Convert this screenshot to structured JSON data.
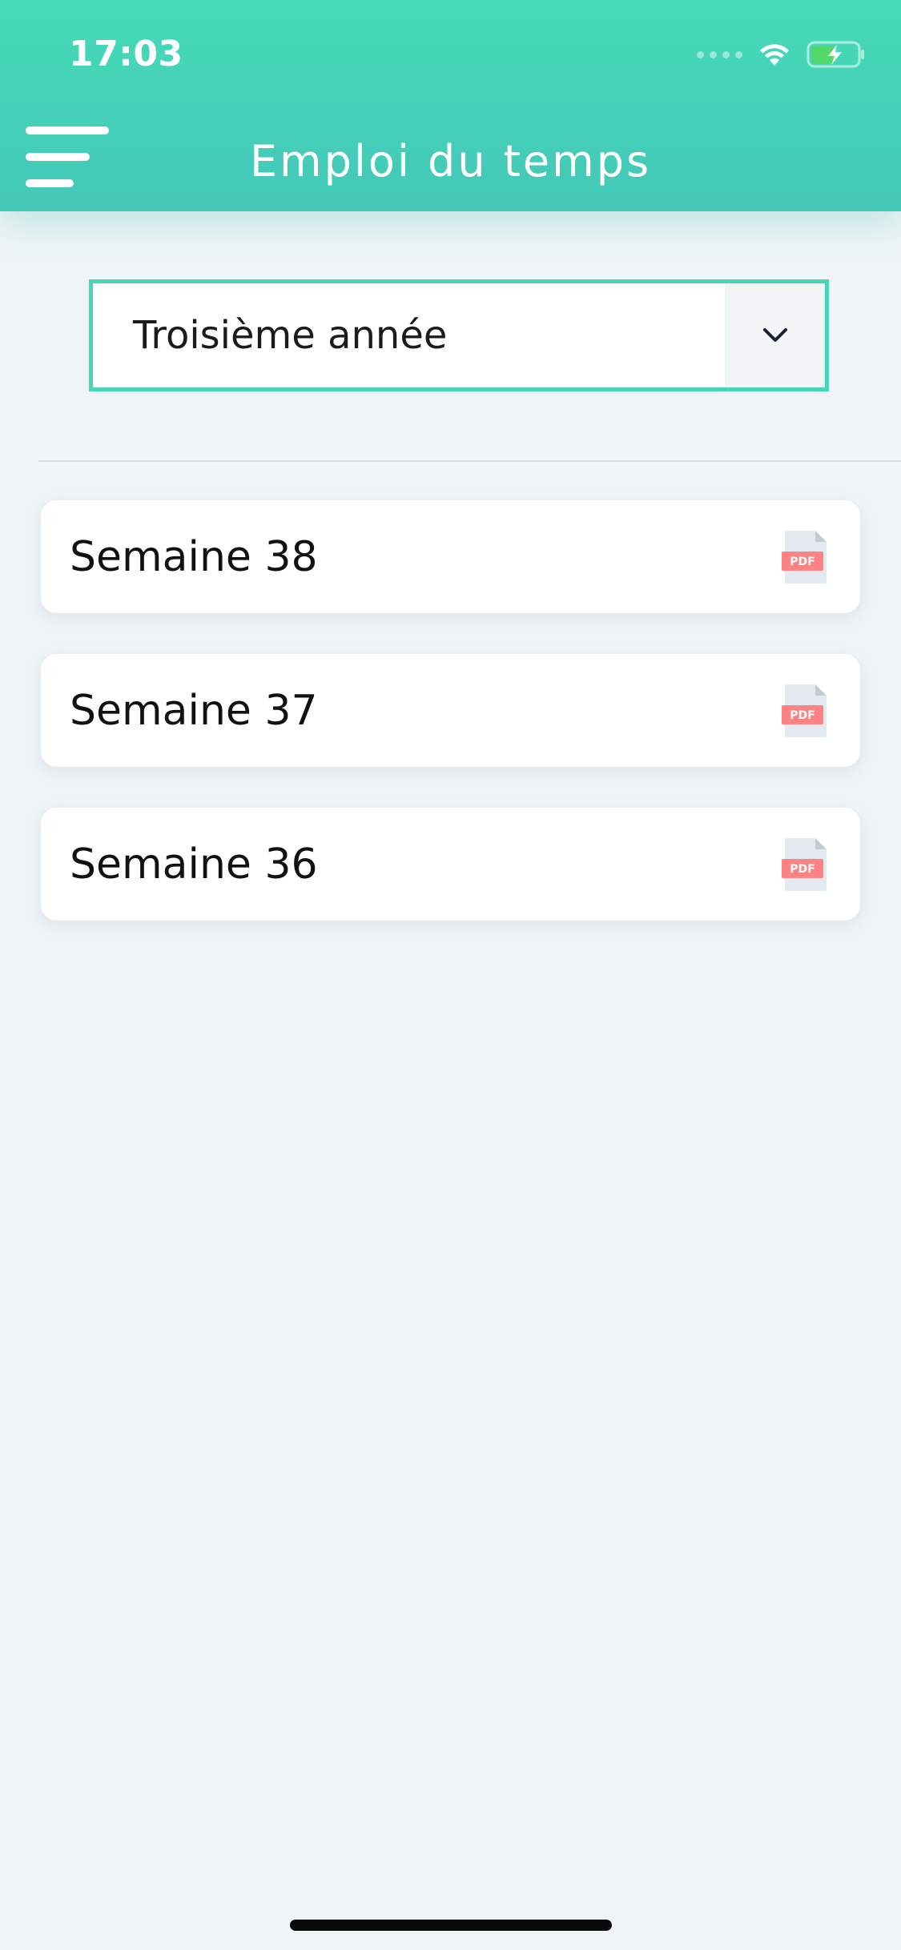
{
  "status_bar": {
    "time": "17:03",
    "icons": [
      "signal-dots-icon",
      "wifi-icon",
      "battery-charging-icon"
    ]
  },
  "header": {
    "title": "Emploi du temps",
    "menu_icon": "hamburger-menu-icon"
  },
  "year_select": {
    "selected": "Troisième année",
    "icon": "chevron-down-icon"
  },
  "weeks": [
    {
      "label": "Semaine 38",
      "icon_label": "PDF"
    },
    {
      "label": "Semaine 37",
      "icon_label": "PDF"
    },
    {
      "label": "Semaine 36",
      "icon_label": "PDF"
    }
  ],
  "colors": {
    "header_accent": "#46dbb9",
    "select_border": "#46d6b6",
    "background": "#eff4f7",
    "pdf_badge": "#fb8383",
    "battery_fill": "#54d86a"
  }
}
